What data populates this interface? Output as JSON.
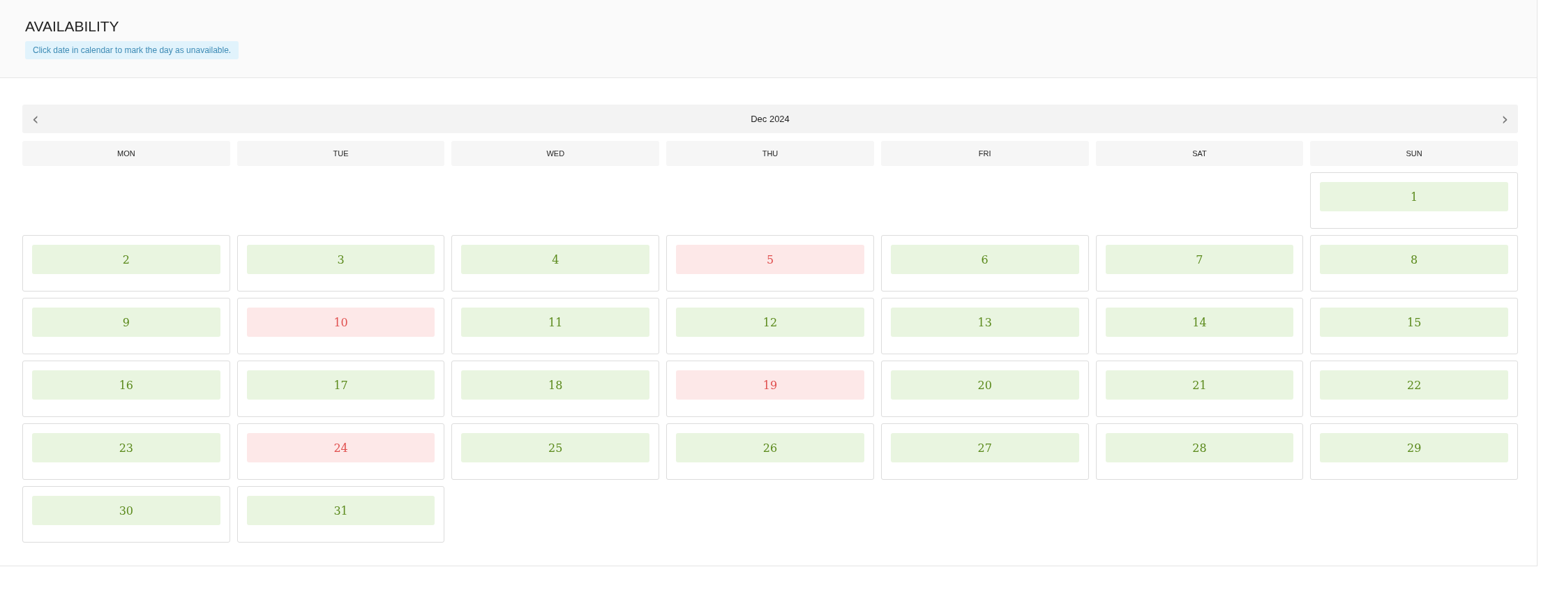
{
  "page": {
    "title": "AVAILABILITY",
    "hint": "Click date in calendar to mark the day as unavailable."
  },
  "calendar": {
    "prev": "‹",
    "month": "Dec 2024",
    "next": "›",
    "weekdays": [
      "MON",
      "TUE",
      "WED",
      "THU",
      "FRI",
      "SAT",
      "SUN"
    ],
    "weeks": [
      [
        {
          "kind": "blank"
        },
        {
          "kind": "blank"
        },
        {
          "kind": "blank"
        },
        {
          "kind": "blank"
        },
        {
          "kind": "blank"
        },
        {
          "kind": "blank"
        },
        {
          "kind": "day",
          "label": "1",
          "unavailable": false
        }
      ],
      [
        {
          "kind": "day",
          "label": "2",
          "unavailable": false
        },
        {
          "kind": "day",
          "label": "3",
          "unavailable": false
        },
        {
          "kind": "day",
          "label": "4",
          "unavailable": false
        },
        {
          "kind": "day",
          "label": "5",
          "unavailable": true
        },
        {
          "kind": "day",
          "label": "6",
          "unavailable": false
        },
        {
          "kind": "day",
          "label": "7",
          "unavailable": false
        },
        {
          "kind": "day",
          "label": "8",
          "unavailable": false
        }
      ],
      [
        {
          "kind": "day",
          "label": "9",
          "unavailable": false
        },
        {
          "kind": "day",
          "label": "10",
          "unavailable": true
        },
        {
          "kind": "day",
          "label": "11",
          "unavailable": false
        },
        {
          "kind": "day",
          "label": "12",
          "unavailable": false
        },
        {
          "kind": "day",
          "label": "13",
          "unavailable": false
        },
        {
          "kind": "day",
          "label": "14",
          "unavailable": false
        },
        {
          "kind": "day",
          "label": "15",
          "unavailable": false
        }
      ],
      [
        {
          "kind": "day",
          "label": "16",
          "unavailable": false
        },
        {
          "kind": "day",
          "label": "17",
          "unavailable": false
        },
        {
          "kind": "day",
          "label": "18",
          "unavailable": false
        },
        {
          "kind": "day",
          "label": "19",
          "unavailable": true
        },
        {
          "kind": "day",
          "label": "20",
          "unavailable": false
        },
        {
          "kind": "day",
          "label": "21",
          "unavailable": false
        },
        {
          "kind": "day",
          "label": "22",
          "unavailable": false
        }
      ],
      [
        {
          "kind": "day",
          "label": "23",
          "unavailable": false
        },
        {
          "kind": "day",
          "label": "24",
          "unavailable": true
        },
        {
          "kind": "day",
          "label": "25",
          "unavailable": false
        },
        {
          "kind": "day",
          "label": "26",
          "unavailable": false
        },
        {
          "kind": "day",
          "label": "27",
          "unavailable": false
        },
        {
          "kind": "day",
          "label": "28",
          "unavailable": false
        },
        {
          "kind": "day",
          "label": "29",
          "unavailable": false
        }
      ],
      [
        {
          "kind": "day",
          "label": "30",
          "unavailable": false
        },
        {
          "kind": "day",
          "label": "31",
          "unavailable": false
        }
      ]
    ]
  }
}
